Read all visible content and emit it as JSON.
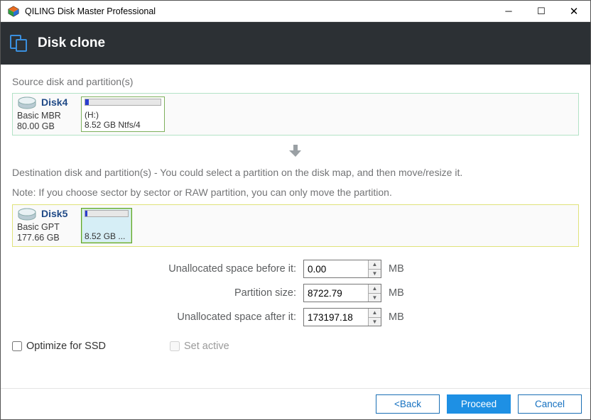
{
  "titlebar": {
    "app_name": "QILING Disk Master Professional"
  },
  "header": {
    "title": "Disk clone"
  },
  "source": {
    "heading": "Source disk and partition(s)",
    "disk": {
      "name": "Disk4",
      "type": "Basic MBR",
      "size": "80.00 GB"
    },
    "partition": {
      "label1": "(H:)",
      "label2": "8.52 GB Ntfs/4",
      "used_pct": 5
    }
  },
  "destination": {
    "heading": "Destination disk and partition(s) - You could select a partition on the disk map, and then move/resize it.",
    "note": "Note: If you choose sector by sector or RAW partition, you can only move the partition.",
    "disk": {
      "name": "Disk5",
      "type": "Basic GPT",
      "size": "177.66 GB"
    },
    "partition": {
      "label": "8.52 GB ...",
      "used_pct": 5
    }
  },
  "fields": {
    "before": {
      "label": "Unallocated space before it:",
      "value": "0.00",
      "unit": "MB"
    },
    "size": {
      "label": "Partition size:",
      "value": "8722.79",
      "unit": "MB"
    },
    "after": {
      "label": "Unallocated space after it:",
      "value": "173197.18",
      "unit": "MB"
    }
  },
  "checks": {
    "optimize_ssd": {
      "label": "Optimize for SSD",
      "checked": false,
      "enabled": true
    },
    "set_active": {
      "label": "Set active",
      "checked": false,
      "enabled": false
    }
  },
  "footer": {
    "back": "<Back",
    "proceed": "Proceed",
    "cancel": "Cancel"
  }
}
